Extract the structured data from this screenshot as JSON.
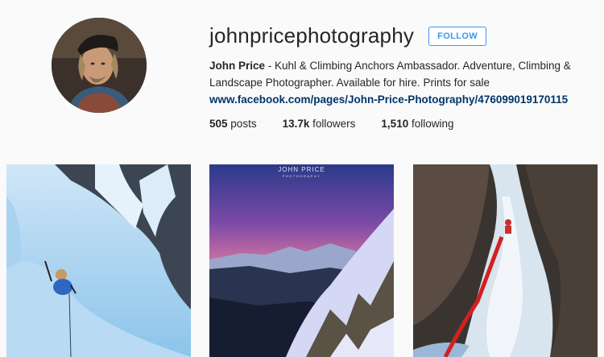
{
  "profile": {
    "username": "johnpricephotography",
    "follow_label": "FOLLOW",
    "name": "John Price",
    "bio_text": " - Kuhl & Climbing Anchors Ambassador. Adventure, Climbing & Landscape Photographer. Available for hire. Prints for sale",
    "website": "www.facebook.com/pages/John-Price-Photography/476099019170115"
  },
  "stats": {
    "posts_count": "505",
    "posts_label": "posts",
    "followers_count": "13.7k",
    "followers_label": "followers",
    "following_count": "1,510",
    "following_label": "following"
  },
  "posts": [
    {
      "subject": "ice-climber-frozen-waterfall"
    },
    {
      "subject": "sunset-mountain-landscape",
      "watermark_text": "JOHN PRICE",
      "watermark_sub": "PHOTOGRAPHY"
    },
    {
      "subject": "ice-climber-canyon-red-rope"
    }
  ],
  "colors": {
    "follow_accent": "#3897f0",
    "link": "#003569",
    "background": "#fafafa"
  }
}
